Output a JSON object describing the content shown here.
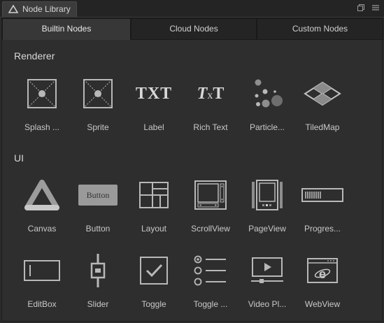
{
  "panel": {
    "title": "Node Library"
  },
  "tabs": [
    {
      "label": "Builtin Nodes",
      "active": true
    },
    {
      "label": "Cloud Nodes",
      "active": false
    },
    {
      "label": "Custom Nodes",
      "active": false
    }
  ],
  "sections": {
    "renderer": {
      "title": "Renderer",
      "nodes": [
        {
          "label": "Splash ...",
          "icon": "splash-icon"
        },
        {
          "label": "Sprite",
          "icon": "sprite-icon"
        },
        {
          "label": "Label",
          "icon": "label-icon",
          "glyph": "TXT"
        },
        {
          "label": "Rich Text",
          "icon": "rich-text-icon"
        },
        {
          "label": "Particle...",
          "icon": "particle-icon"
        },
        {
          "label": "TiledMap",
          "icon": "tiledmap-icon"
        }
      ]
    },
    "ui": {
      "title": "UI",
      "nodes": [
        {
          "label": "Canvas",
          "icon": "canvas-icon"
        },
        {
          "label": "Button",
          "icon": "button-icon",
          "glyph": "Button"
        },
        {
          "label": "Layout",
          "icon": "layout-icon"
        },
        {
          "label": "ScrollView",
          "icon": "scrollview-icon"
        },
        {
          "label": "PageView",
          "icon": "pageview-icon"
        },
        {
          "label": "Progres...",
          "icon": "progressbar-icon"
        },
        {
          "label": "EditBox",
          "icon": "editbox-icon"
        },
        {
          "label": "Slider",
          "icon": "slider-icon"
        },
        {
          "label": "Toggle",
          "icon": "toggle-icon"
        },
        {
          "label": "Toggle ...",
          "icon": "toggle-group-icon"
        },
        {
          "label": "Video Pl...",
          "icon": "video-player-icon"
        },
        {
          "label": "WebView",
          "icon": "webview-icon"
        }
      ]
    }
  },
  "colors": {
    "background": "#2b2b2b",
    "icon_stroke": "#b8b8b8",
    "text": "#c8c8c8"
  }
}
